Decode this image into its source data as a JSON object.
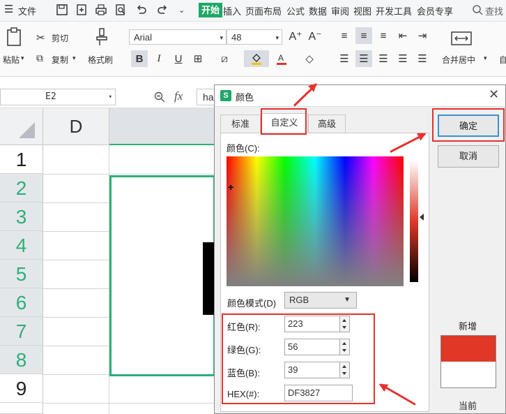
{
  "menubar": {
    "file": "文件",
    "tabs": [
      "开始",
      "插入",
      "页面布局",
      "公式",
      "数据",
      "审阅",
      "视图",
      "开发工具",
      "会员专享"
    ],
    "search": "查找"
  },
  "ribbon": {
    "paste": "粘贴",
    "cut": "剪切",
    "copy": "复制",
    "format_painter": "格式刷",
    "font_name": "Arial",
    "font_size": "48",
    "bold": "B",
    "italic": "I",
    "underline": "U",
    "merge_center": "合并居中",
    "auto_wrap": "自"
  },
  "formula_bar": {
    "cell_ref": "E2",
    "fx": "fx",
    "content_partial": "ha"
  },
  "grid": {
    "column": "D",
    "rows": [
      "1",
      "2",
      "3",
      "4",
      "5",
      "6",
      "7",
      "8",
      "9"
    ],
    "selected_rows": [
      "2",
      "3",
      "4",
      "5",
      "6",
      "7",
      "8"
    ]
  },
  "dialog": {
    "title_icon": "S",
    "title": "颜色",
    "tabs": [
      "标准",
      "自定义",
      "高级"
    ],
    "active_tab": "自定义",
    "color_label": "颜色(C):",
    "mode_label": "颜色模式(D)",
    "mode_value": "RGB",
    "fields": [
      {
        "label": "红色(R):",
        "value": "223"
      },
      {
        "label": "绿色(G):",
        "value": "56"
      },
      {
        "label": "蓝色(B):",
        "value": "39"
      },
      {
        "label": "HEX(#):",
        "value": "DF3827"
      }
    ],
    "ok": "确定",
    "cancel": "取消",
    "new_label": "新增",
    "current_label": "当前",
    "new_color": "#DF3827",
    "current_color": "#FFFFFF"
  },
  "colors": {
    "accent_green": "#1fa868",
    "highlight_red": "#e5322d"
  }
}
